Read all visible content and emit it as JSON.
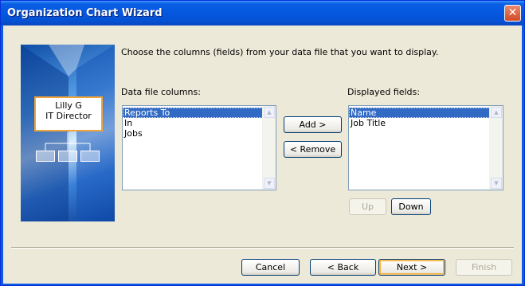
{
  "window": {
    "title": "Organization Chart Wizard",
    "close_glyph": "✕"
  },
  "illustration": {
    "name": "Lilly G",
    "role": "IT Director"
  },
  "instruction": "Choose the columns (fields) from your data file that you want to display.",
  "data_file_columns": {
    "label": "Data file columns:",
    "items": [
      {
        "text": "Reports To",
        "selected": true
      },
      {
        "text": "In",
        "selected": false
      },
      {
        "text": "Jobs",
        "selected": false
      }
    ]
  },
  "displayed_fields": {
    "label": "Displayed fields:",
    "items": [
      {
        "text": "Name",
        "selected": true
      },
      {
        "text": "Job Title",
        "selected": false
      }
    ]
  },
  "buttons": {
    "add": "Add >",
    "remove": "< Remove",
    "up": "Up",
    "down": "Down",
    "cancel": "Cancel",
    "back": "< Back",
    "next": "Next >",
    "finish": "Finish"
  },
  "colors": {
    "titlebar": "#0558e0",
    "selection": "#316ac5",
    "dialog_bg": "#ece9d8"
  }
}
